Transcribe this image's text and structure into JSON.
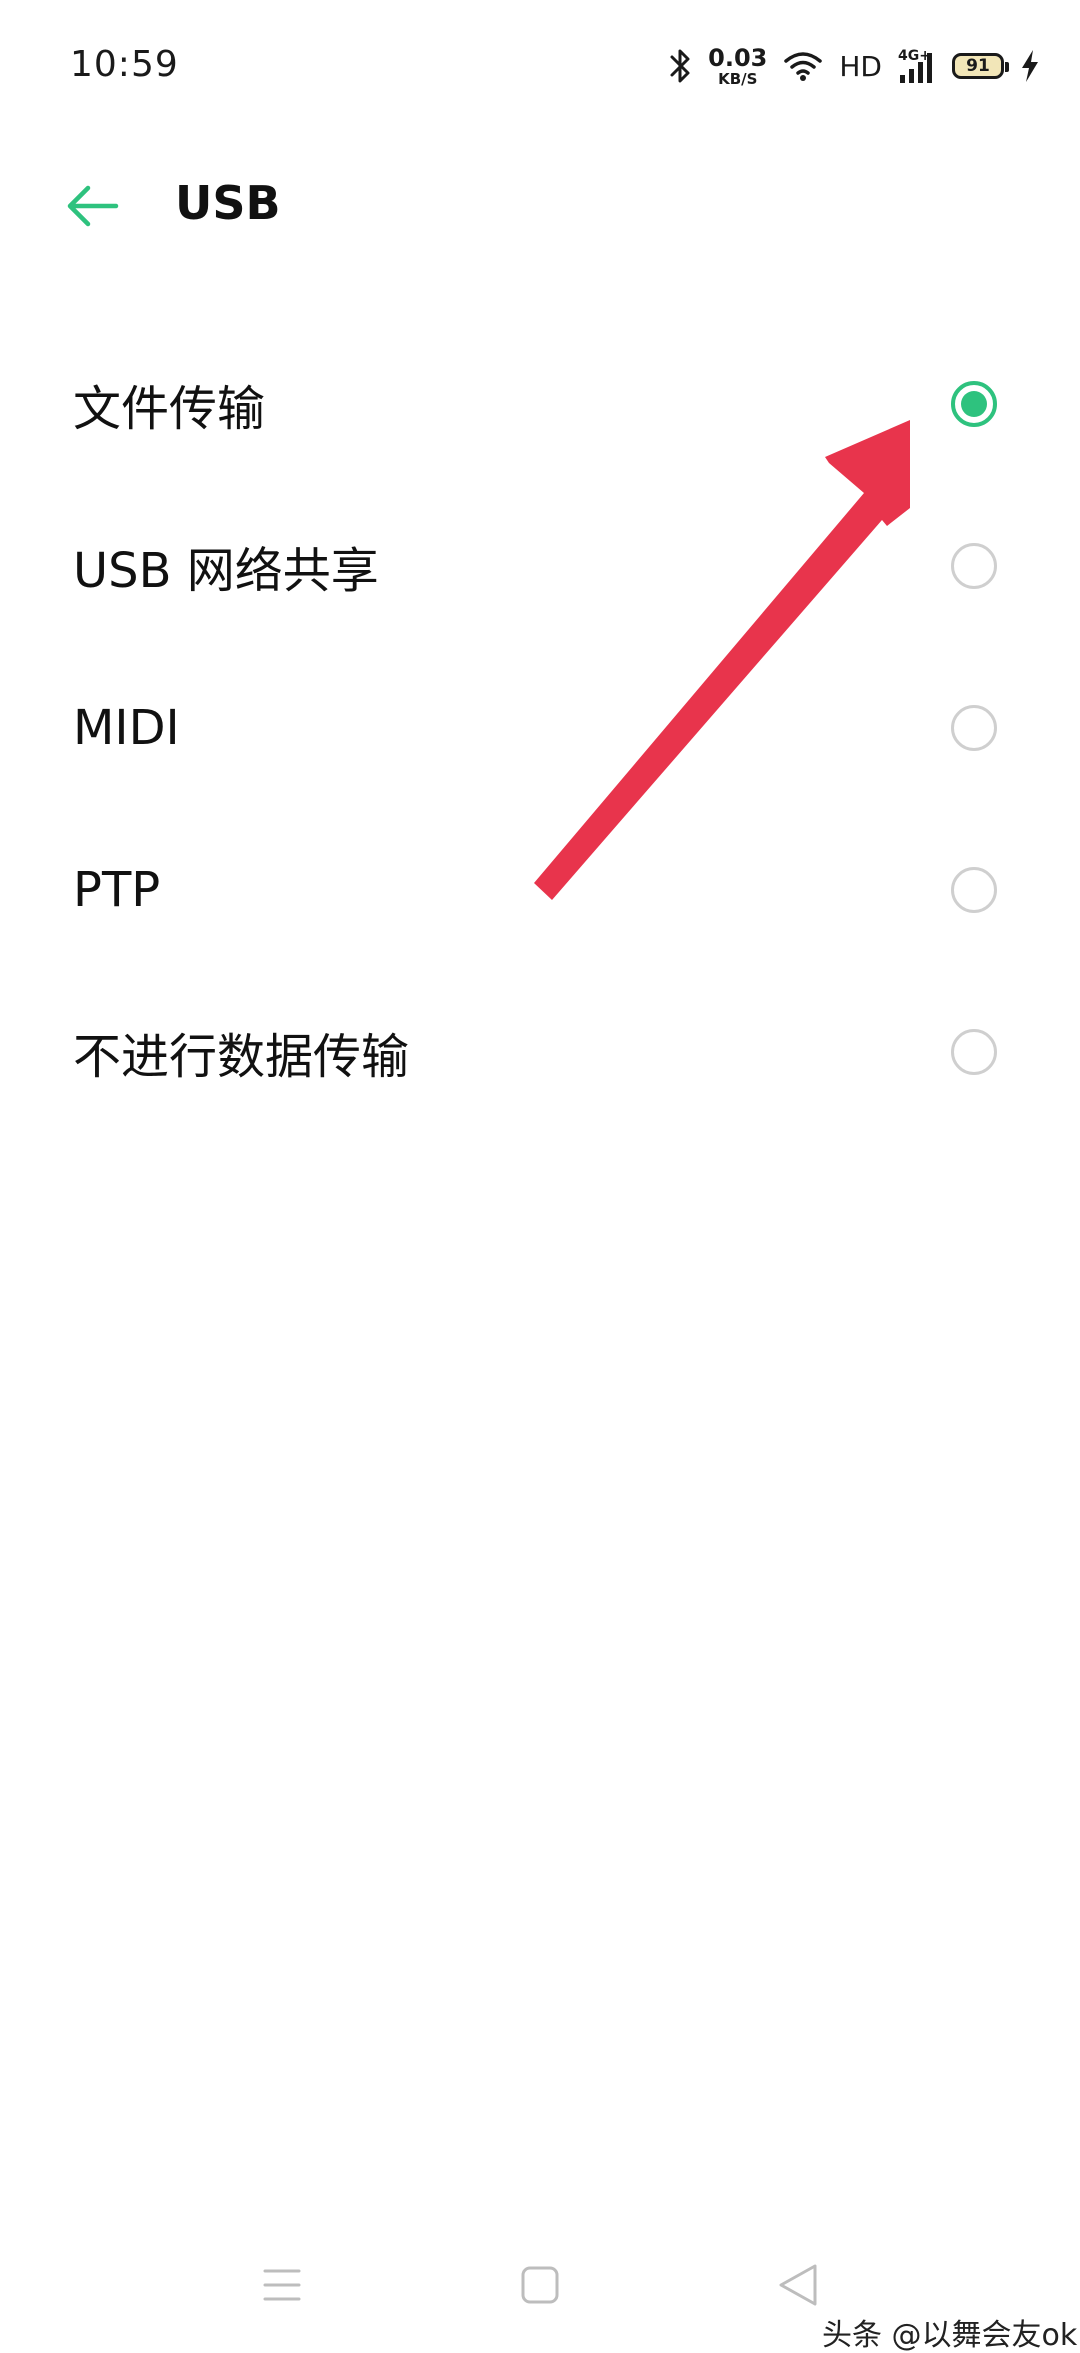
{
  "status_bar": {
    "time": "10:59",
    "net_speed_value": "0.03",
    "net_speed_unit": "KB/S",
    "hd_label": "HD",
    "network_type": "4G+",
    "battery_level": "91",
    "icons": [
      "bluetooth-icon",
      "wifi-icon",
      "signal-icon",
      "battery-icon",
      "charging-icon"
    ]
  },
  "header": {
    "title": "USB",
    "back_icon": "arrow-left-icon"
  },
  "options": [
    {
      "label": "文件传输",
      "selected": true
    },
    {
      "label": "USB 网络共享",
      "selected": false
    },
    {
      "label": "MIDI",
      "selected": false
    },
    {
      "label": "PTP",
      "selected": false
    },
    {
      "label": "不进行数据传输",
      "selected": false
    }
  ],
  "nav_bar": {
    "icons": [
      "menu-icon",
      "home-icon",
      "back-triangle-icon"
    ]
  },
  "watermark": "头条 @以舞会友ok",
  "colors": {
    "accent": "#2ec27e",
    "radio_border": "#cfcfcf",
    "annotation_arrow": "#e8344c",
    "text": "#111111",
    "background": "#ffffff"
  }
}
